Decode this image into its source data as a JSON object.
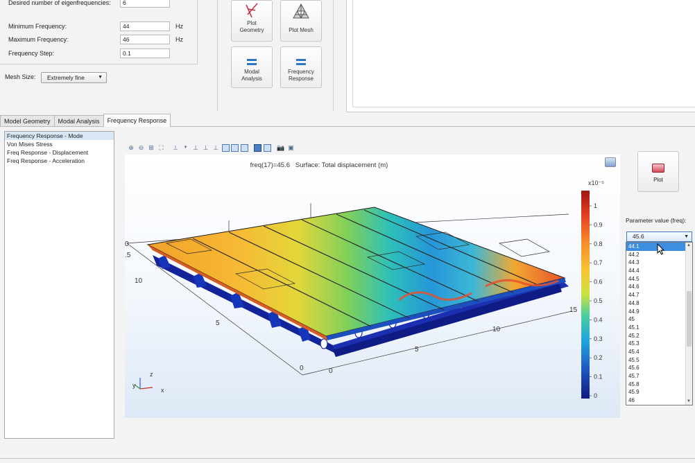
{
  "settings": {
    "eigen_label": "Desired number of eigenfrequencies:",
    "eigen_value": "6",
    "min_freq_label": "Minimum Frequency:",
    "min_freq_value": "44",
    "max_freq_label": "Maximum Frequency:",
    "max_freq_value": "46",
    "freq_step_label": "Frequency Step:",
    "freq_step_value": "0.1",
    "unit": "Hz",
    "mesh_label": "Mesh Size:",
    "mesh_value": "Extremely fine"
  },
  "actions": {
    "plot_geometry": "Plot Geometry",
    "plot_mesh": "Plot Mesh",
    "modal_analysis": "Modal Analysis",
    "frequency_response": "Frequency Response"
  },
  "tabs": [
    "Model Geometry",
    "Modal Analysis",
    "Frequency Response"
  ],
  "active_tab": 2,
  "results": {
    "items": [
      "Frequency Response - Mode",
      "Von Mises Stress",
      "Freq Response - Displacement",
      "Freq Response - Acceleration"
    ],
    "selected": 0
  },
  "graphics": {
    "title": "freq(17)=45.6   Surface: Total displacement (m)",
    "exponent": "x10⁻⁵",
    "colorbar_ticks": [
      "1",
      "0.9",
      "0.8",
      "0.7",
      "0.6",
      "0.5",
      "0.4",
      "0.3",
      "0.2",
      "0.1",
      "0"
    ],
    "axis_left_ticks": [
      "0",
      ".5",
      "10",
      "5",
      "0"
    ],
    "axis_front_ticks": [
      "0",
      "5",
      "10",
      "15"
    ],
    "axis_triad": {
      "y": "y",
      "z": "z",
      "x": "x"
    },
    "colormap": [
      "#a01515",
      "#d7301f",
      "#f46d2b",
      "#fbab2f",
      "#e8d838",
      "#9fd64a",
      "#37c3a0",
      "#1c96d4",
      "#1f5cc4",
      "#1b2ea3",
      "#101c82"
    ]
  },
  "right_panel": {
    "plot_button": "Plot",
    "param_label": "Parameter value (freq):",
    "param_value": "45.6",
    "options": [
      "44.1",
      "44.2",
      "44.3",
      "44.4",
      "44.5",
      "44.6",
      "44.7",
      "44.8",
      "44.9",
      "45",
      "45.1",
      "45.2",
      "45.3",
      "45.4",
      "45.5",
      "45.6",
      "45.7",
      "45.8",
      "45.9",
      "46"
    ],
    "highlighted": 0
  }
}
